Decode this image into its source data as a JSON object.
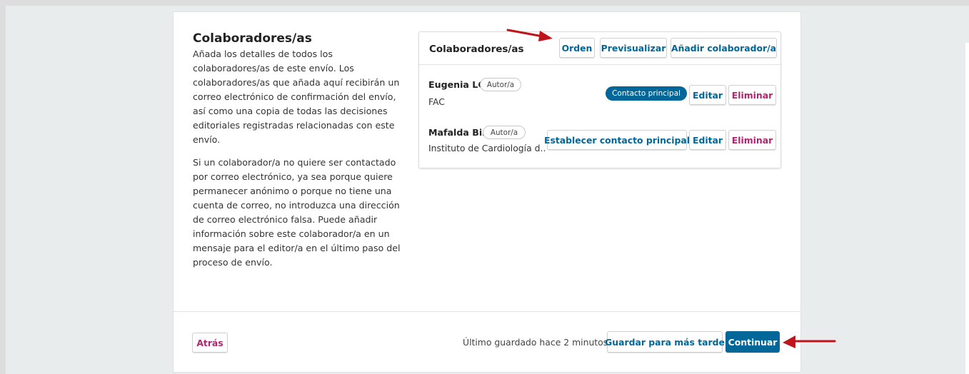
{
  "section": {
    "title": "Colaboradores/as",
    "paragraph1": "Añada los detalles de todos los colaboradores/as de este envío. Los colaboradores/as que añada aquí recibirán un correo electrónico de confirmación del envío, así como una copia de todas las decisiones editoriales registradas relacionadas con este envío.",
    "paragraph2": "Si un colaborador/a no quiere ser contactado por correo electrónico, ya sea porque quiere permanecer anónimo o porque no tiene una cuenta de correo, no introduzca una dirección de correo electrónico falsa. Puede añadir información sobre este colaborador/a en un mensaje para el editor/a en el último paso del proceso de envío."
  },
  "contributors_panel": {
    "title": "Colaboradores/as",
    "order_label": "Orden",
    "preview_label": "Previsualizar",
    "add_label": "Añadir colaborador/a",
    "contributors": [
      {
        "name": "Eugenia LC",
        "role": "Autor/a",
        "affiliation": "FAC",
        "primary_contact_label": "Contacto principal",
        "edit_label": "Editar",
        "delete_label": "Eliminar"
      },
      {
        "name": "Mafalda Bir",
        "role": "Autor/a",
        "affiliation": "Instituto de Cardiología d...",
        "set_primary_label": "Establecer contacto principal",
        "edit_label": "Editar",
        "delete_label": "Eliminar"
      }
    ]
  },
  "footer": {
    "back_label": "Atrás",
    "saved_status": "Último guardado hace 2 minutos",
    "save_later_label": "Guardar para más tarde",
    "continue_label": "Continuar"
  },
  "colors": {
    "accent": "#006798",
    "danger": "#b3246d",
    "annotation_arrow": "#c0141b"
  }
}
